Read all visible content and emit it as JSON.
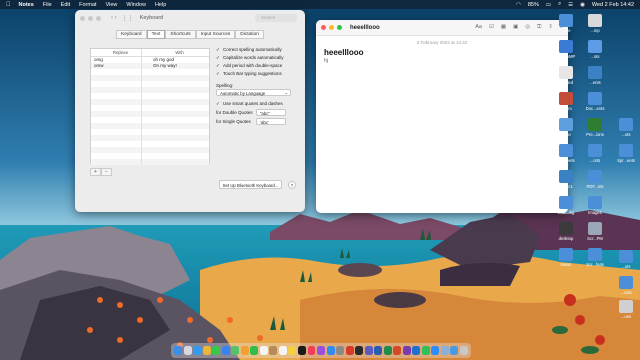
{
  "menubar": {
    "app_name": "Notes",
    "items": [
      "File",
      "Edit",
      "Format",
      "View",
      "Window",
      "Help"
    ],
    "battery": "85%",
    "datetime": "Wed 2 Feb  14:42"
  },
  "keyboard_window": {
    "title": "Keyboard",
    "search_placeholder": "Search",
    "tabs": [
      "Keyboard",
      "Text",
      "Shortcuts",
      "Input Sources",
      "Dictation"
    ],
    "active_tab": "Text",
    "table": {
      "headers": [
        "Replace",
        "With"
      ],
      "rows": [
        {
          "replace": "omg",
          "with": "oh my god"
        },
        {
          "replace": "omw",
          "with": "On my way!"
        }
      ]
    },
    "add_label": "+",
    "remove_label": "−",
    "options": [
      {
        "label": "Correct spelling automatically",
        "checked": true
      },
      {
        "label": "Capitalize words automatically",
        "checked": true
      },
      {
        "label": "Add period with double-space",
        "checked": true
      },
      {
        "label": "Touch Bar typing suggestions",
        "checked": true
      }
    ],
    "spelling_label": "Spelling:",
    "spelling_value": "Automatic by Language",
    "smart_quotes": {
      "label": "Use smart quotes and dashes",
      "checked": true
    },
    "double_quotes_label": "for Double Quotes",
    "double_quotes_value": "“abc”",
    "single_quotes_label": "for Single Quotes",
    "single_quotes_value": "‘abc’",
    "bluetooth_button": "Set Up Bluetooth Keyboard...",
    "help_label": "?"
  },
  "notes_window": {
    "title": "heeelllooo",
    "date": "2 February 2022 at 14:42",
    "heading": "heeelllooo",
    "body_line": "hj"
  },
  "desktop_icons": [
    {
      "label": "...ule",
      "color": "#4a8fd8"
    },
    {
      "label": "...mp",
      "color": "#d9d9d9"
    },
    {
      "label": "BO...AMP",
      "color": "#3a7bd5"
    },
    {
      "label": "...ots",
      "color": "#5c9ce6"
    },
    {
      "label": "Untitled",
      "color": "#e6e6e6"
    },
    {
      "label": "...ents",
      "color": "#3b82c4"
    },
    {
      "label": "...intro",
      "color": "#c44d3a"
    },
    {
      "label": "Doc...ents",
      "color": "#4a8fd8"
    },
    {
      "label": "...roo",
      "color": "#5e9fe0"
    },
    {
      "label": "Pre...ions",
      "color": "#2e7d32"
    },
    {
      "label": "...ots",
      "color": "#4a8fd8"
    },
    {
      "label": "Scr...eets",
      "color": "#4a8fd8"
    },
    {
      "label": "...orts",
      "color": "#4a8fd8"
    },
    {
      "label": "Spr...eets",
      "color": "#4a8fd8"
    },
    {
      "label": "music1",
      "color": "#3b82c4"
    },
    {
      "label": "PDF...nts",
      "color": "#4a8fd8"
    },
    {
      "label": "Cab...ing",
      "color": "#4a8fd8"
    },
    {
      "label": "Images",
      "color": "#4a8fd8"
    },
    {
      "label": "desktop",
      "color": "#3b3b3b"
    },
    {
      "label": "Scr...PM",
      "color": "#9aa7b8"
    },
    {
      "label": "music",
      "color": "#4a8fd8"
    },
    {
      "label": "Scr...huts",
      "color": "#4a8fd8"
    },
    {
      "label": "...uts",
      "color": "#4a8fd8"
    },
    {
      "label": "...cuts",
      "color": "#4a8fd8"
    },
    {
      "label": "...ues",
      "color": "#d0d0d0"
    }
  ],
  "dock_apps": [
    {
      "name": "finder",
      "color": "#3b8fe8"
    },
    {
      "name": "launchpad",
      "color": "#d8d8e0"
    },
    {
      "name": "safari",
      "color": "#2f9cf0"
    },
    {
      "name": "chrome",
      "color": "#e8b838"
    },
    {
      "name": "messages",
      "color": "#37c84a"
    },
    {
      "name": "mail",
      "color": "#3a84f0"
    },
    {
      "name": "maps",
      "color": "#58c06a"
    },
    {
      "name": "photos",
      "color": "#f0a030"
    },
    {
      "name": "facetime",
      "color": "#2ebd4a"
    },
    {
      "name": "calendar",
      "color": "#f4f4f4"
    },
    {
      "name": "contacts",
      "color": "#b68a5a"
    },
    {
      "name": "reminders",
      "color": "#f4f4f4"
    },
    {
      "name": "notes",
      "color": "#f6d040"
    },
    {
      "name": "tv",
      "color": "#1a1a1a"
    },
    {
      "name": "music",
      "color": "#f43c58"
    },
    {
      "name": "podcasts",
      "color": "#9a4ee0"
    },
    {
      "name": "app-store",
      "color": "#2f8cf0"
    },
    {
      "name": "system-preferences",
      "color": "#8a8a8a"
    },
    {
      "name": "pdf-reader",
      "color": "#d83a2a"
    },
    {
      "name": "terminal",
      "color": "#2a2a2a"
    },
    {
      "name": "teams",
      "color": "#5a5ac0"
    },
    {
      "name": "word",
      "color": "#2a5cb0"
    },
    {
      "name": "excel",
      "color": "#1f8c4a"
    },
    {
      "name": "powerpoint",
      "color": "#d24a2a"
    },
    {
      "name": "onenote",
      "color": "#7a3ab0"
    },
    {
      "name": "outlook",
      "color": "#1e6fd0"
    },
    {
      "name": "whatsapp",
      "color": "#2fc05a"
    },
    {
      "name": "zoom",
      "color": "#2d8cff"
    },
    {
      "name": "preview",
      "color": "#8ab0d8"
    },
    {
      "name": "downloads",
      "color": "#4a9ae0"
    },
    {
      "name": "trash",
      "color": "#c8c8c8"
    }
  ]
}
